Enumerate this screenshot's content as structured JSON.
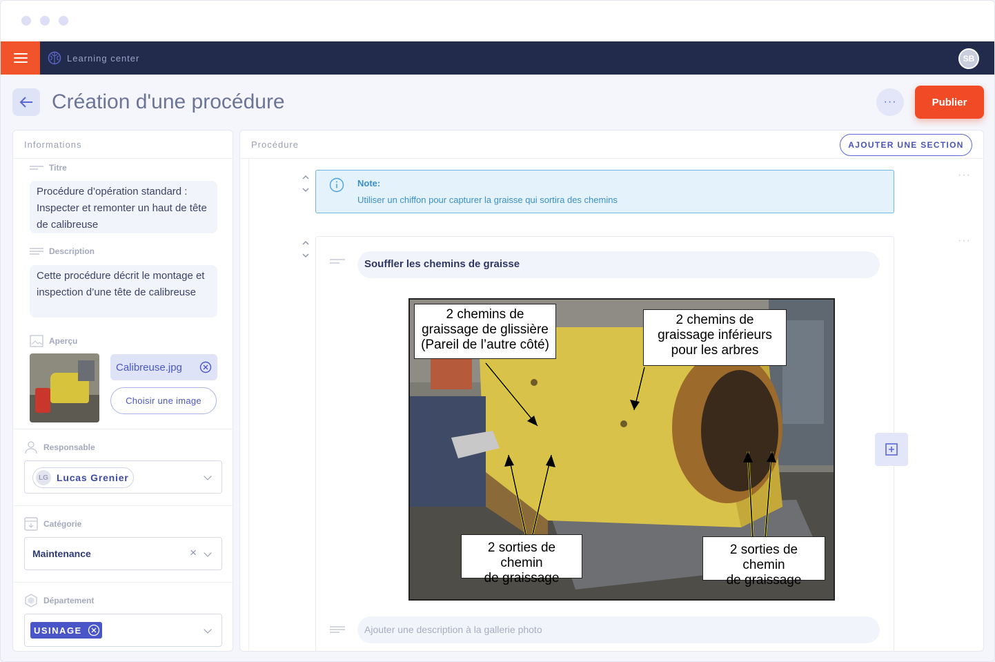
{
  "app": {
    "name": "Learning center",
    "user_initials": "SB"
  },
  "header": {
    "title": "Création d'une procédure",
    "more": "···",
    "publish": "Publier"
  },
  "info_panel": {
    "title": "Informations",
    "titre_label": "Titre",
    "titre_value": "Procédure d’opération standard : Inspecter et remonter un haut de tête de calibreuse",
    "description_label": "Description",
    "description_value": "Cette procédure décrit le montage et inspection d’une tête de calibreuse",
    "apercu_label": "Aperçu",
    "file_name": "Calibreuse.jpg",
    "choose_image": "Choisir une image",
    "responsable_label": "Responsable",
    "responsable_initials": "LG",
    "responsable_name": "Lucas Grenier",
    "categorie_label": "Catégorie",
    "categorie_value": "Maintenance",
    "categorie_clear": "×",
    "departement_label": "Département",
    "departement_tag": "USINAGE"
  },
  "procedure_panel": {
    "title": "Procédure",
    "add_section": "AJOUTER UNE SECTION",
    "note_title": "Note:",
    "note_text": "Utiliser un chiffon pour capturer la graisse qui sortira des chemins",
    "step_title": "Souffler les chemins de graisse",
    "gallery_placeholder": "Ajouter une description à la gallerie photo",
    "callouts": {
      "top_left": [
        "2 chemins de",
        "graissage de glissière",
        "(Pareil de l’autre côté)"
      ],
      "top_right": [
        "2 chemins de",
        "graissage inférieurs",
        "pour les arbres"
      ],
      "bottom_left": [
        "2 sorties de chemin",
        "de graissage"
      ],
      "bottom_right": [
        "2 sorties de chemin",
        "de graissage"
      ]
    }
  },
  "colors": {
    "accent": "#f04a26",
    "navbar": "#232b4c",
    "primary": "#5a67d8",
    "info": "#71b6e2",
    "machine_yellow": "#d9c24a"
  }
}
